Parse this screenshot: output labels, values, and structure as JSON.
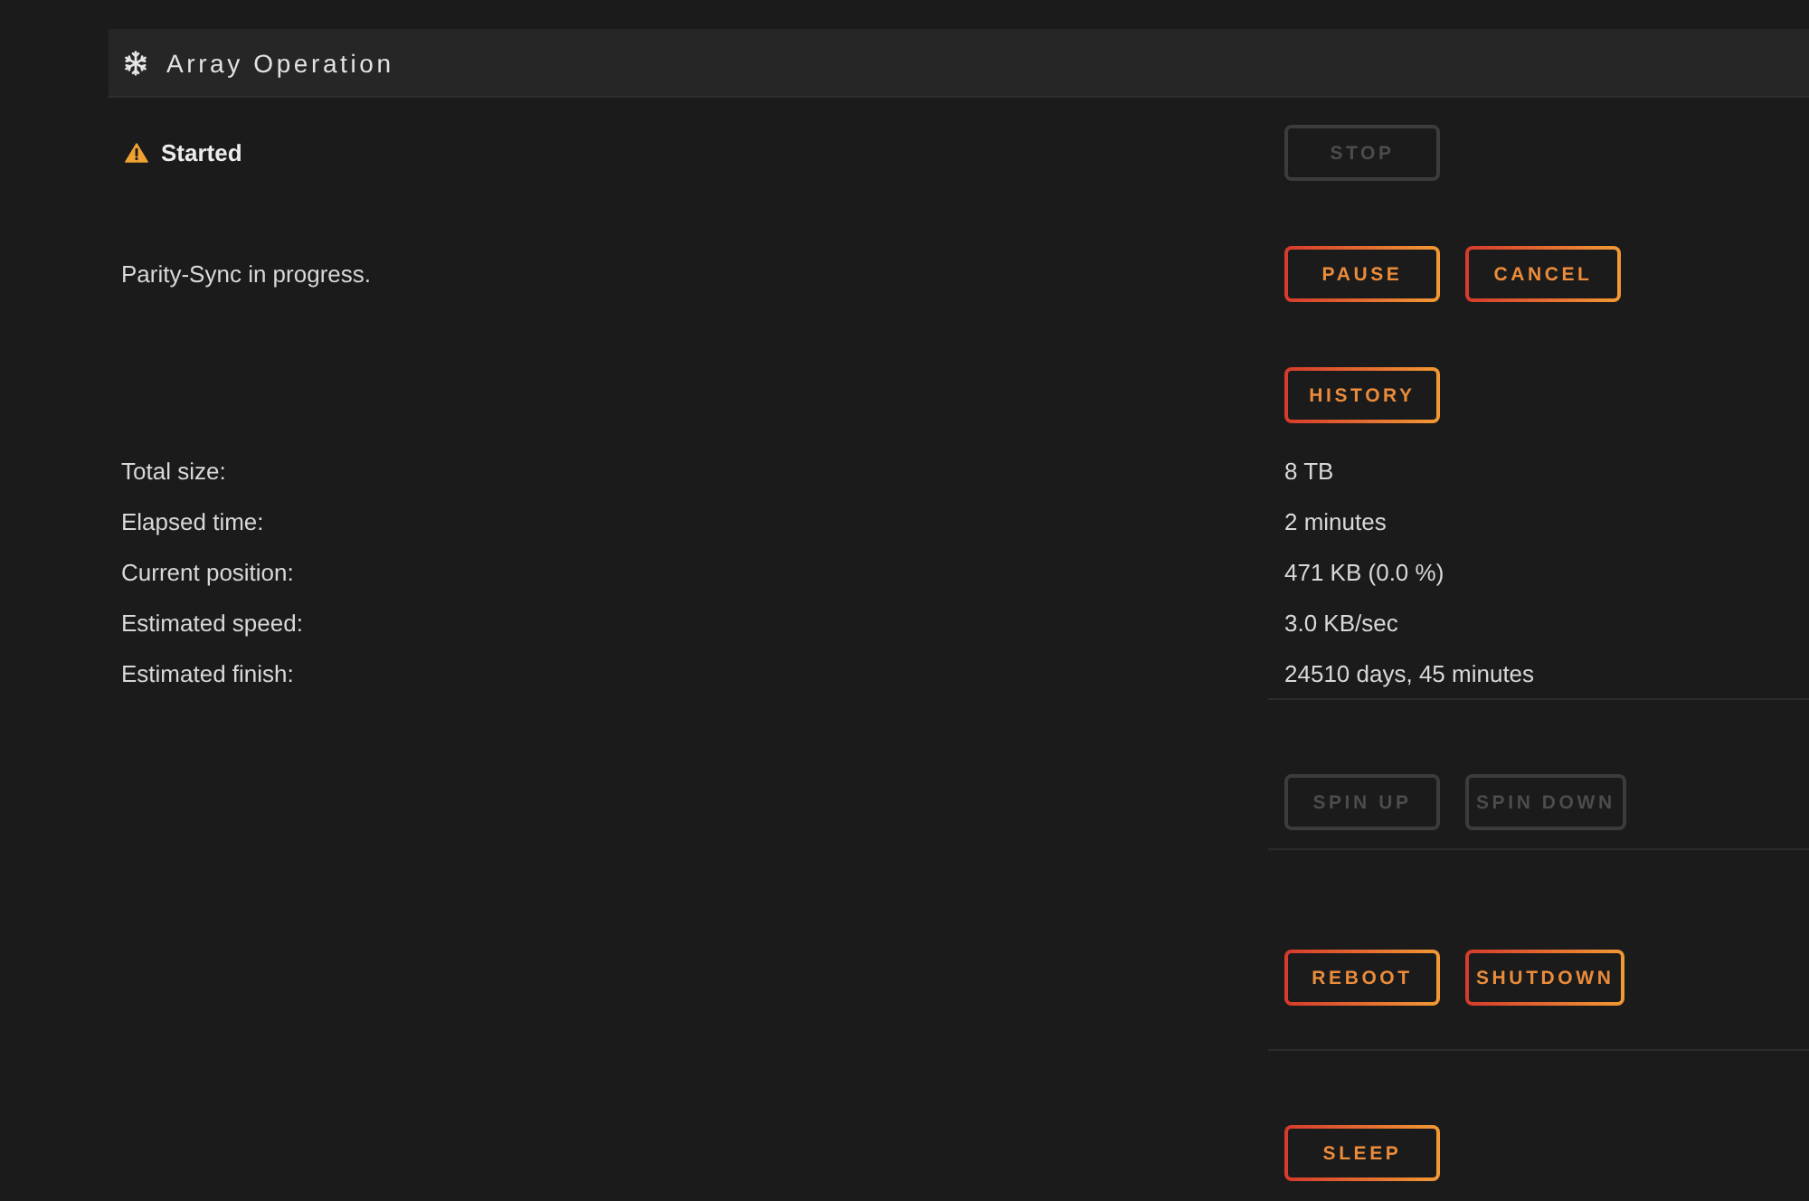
{
  "panel": {
    "title": "Array Operation"
  },
  "rows": [
    {
      "kind": "status",
      "text": "Started",
      "buttons": [
        {
          "label": "STOP",
          "disabled": true
        }
      ]
    },
    {
      "kind": "message",
      "text": "Parity-Sync in progress.",
      "buttons": [
        {
          "label": "PAUSE",
          "disabled": false
        },
        {
          "label": "CANCEL",
          "disabled": false
        }
      ]
    },
    {
      "kind": "actions",
      "buttons": [
        {
          "label": "HISTORY",
          "disabled": false
        }
      ]
    }
  ],
  "stats": [
    {
      "label": "Total size:",
      "value": "8 TB"
    },
    {
      "label": "Elapsed time:",
      "value": "2 minutes"
    },
    {
      "label": "Current position:",
      "value": "471 KB (0.0 %)"
    },
    {
      "label": "Estimated speed:",
      "value": "3.0 KB/sec"
    },
    {
      "label": "Estimated finish:",
      "value": "24510 days, 45 minutes"
    }
  ],
  "sections": [
    {
      "buttons": [
        {
          "label": "SPIN UP",
          "disabled": true
        },
        {
          "label": "SPIN DOWN",
          "disabled": true
        }
      ]
    },
    {
      "buttons": [
        {
          "label": "REBOOT",
          "disabled": false
        },
        {
          "label": "SHUTDOWN",
          "disabled": false
        }
      ]
    },
    {
      "buttons": [
        {
          "label": "SLEEP",
          "disabled": false
        }
      ]
    }
  ]
}
